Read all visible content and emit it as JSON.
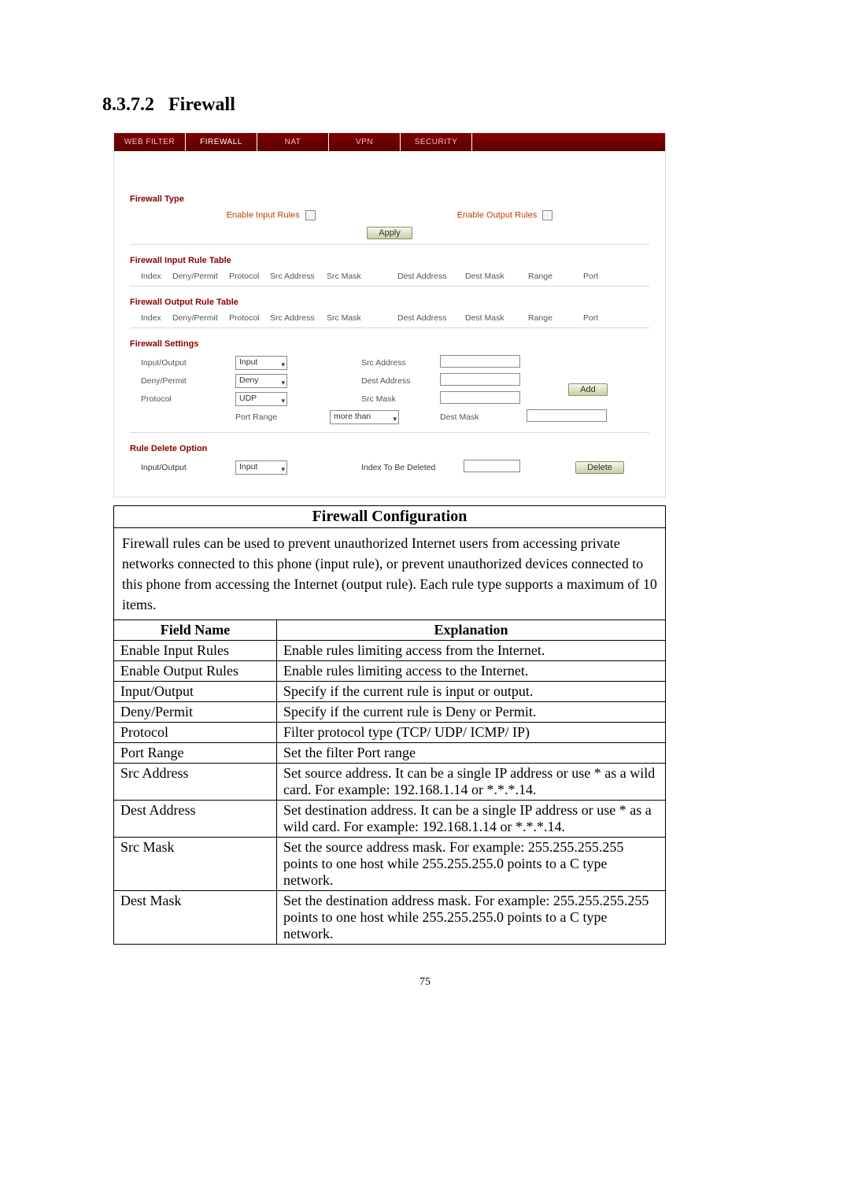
{
  "section": {
    "number": "8.3.7.2",
    "title": "Firewall"
  },
  "page_number": "75",
  "tabs": [
    "WEB FILTER",
    "FIREWALL",
    "NAT",
    "VPN",
    "SECURITY"
  ],
  "firewall_type": {
    "heading": "Firewall Type",
    "enable_input": "Enable Input Rules",
    "enable_output": "Enable Output Rules",
    "apply": "Apply"
  },
  "input_rule": {
    "heading": "Firewall Input Rule Table"
  },
  "output_rule": {
    "heading": "Firewall Output Rule Table"
  },
  "rule_cols": {
    "index": "Index",
    "dp": "Deny/Permit",
    "proto": "Protocol",
    "src": "Src Address",
    "smask": "Src Mask",
    "dest": "Dest Address",
    "dmask": "Dest Mask",
    "range": "Range",
    "port": "Port"
  },
  "settings": {
    "heading": "Firewall Settings",
    "io": "Input/Output",
    "io_val": "Input",
    "dp": "Deny/Permit",
    "dp_val": "Deny",
    "proto": "Protocol",
    "proto_val": "UDP",
    "pr": "Port Range",
    "pr_val": "more than",
    "src": "Src Address",
    "dest": "Dest Address",
    "smask": "Src Mask",
    "dmask": "Dest Mask",
    "add": "Add"
  },
  "delete": {
    "heading": "Rule Delete Option",
    "io": "Input/Output",
    "io_val": "Input",
    "idx": "Index To Be Deleted",
    "btn": "Delete"
  },
  "cfg": {
    "title": "Firewall Configuration",
    "desc": "Firewall rules can be used to prevent unauthorized Internet users from accessing private networks connected to this phone (input rule), or prevent unauthorized devices connected to this phone from accessing the Internet (output rule).   Each rule type supports a maximum of 10 items.",
    "hd_field": "Field Name",
    "hd_expl": "Explanation",
    "rows": [
      {
        "f": "Enable Input Rules",
        "e": "Enable rules limiting access from the Internet."
      },
      {
        "f": "Enable Output Rules",
        "e": "Enable rules limiting access to the Internet."
      },
      {
        "f": "Input/Output",
        "e": "Specify if the current rule is input or output."
      },
      {
        "f": "Deny/Permit",
        "e": "Specify if the current rule is Deny or Permit."
      },
      {
        "f": "Protocol",
        "e": "Filter protocol type (TCP/ UDP/ ICMP/ IP)"
      },
      {
        "f": "Port Range",
        "e": "Set the filter Port range"
      },
      {
        "f": "Src Address",
        "e": "Set source address. It can be a single IP address or use * as a wild card. For example: 192.168.1.14 or   *.*.*.14."
      },
      {
        "f": "Dest Address",
        "e": "Set destination address.   It can be a single IP address or use * as a wild card. For example: 192.168.1.14 or   *.*.*.14."
      },
      {
        "f": "Src Mask",
        "e": "Set the source address mask. For example: 255.255.255.255 points to one host while 255.255.255.0 points to a C type network."
      },
      {
        "f": "Dest Mask",
        "e": "Set the destination address mask. For example: 255.255.255.255 points to one host while 255.255.255.0 points to a C type network."
      }
    ]
  }
}
